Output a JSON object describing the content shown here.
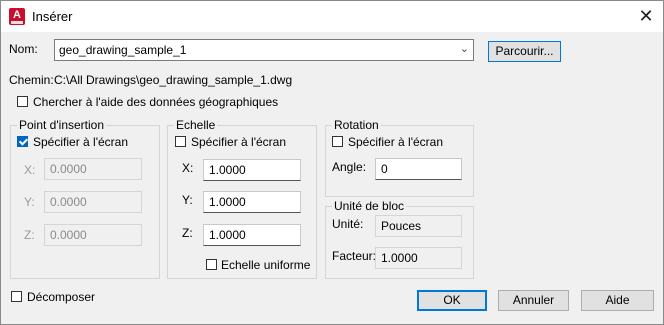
{
  "window": {
    "title": "Insérer",
    "close_glyph": "✕",
    "app_icon": "autocad-icon",
    "app_icon_letter": "A"
  },
  "name": {
    "label": "Nom:",
    "value": "geo_drawing_sample_1",
    "browse_label": "Parcourir..."
  },
  "path": {
    "label": "Chemin:",
    "value": "C:\\All Drawings\\geo_drawing_sample_1.dwg"
  },
  "geo_search": {
    "label": "Chercher à l'aide des données géographiques",
    "checked": false
  },
  "insertion": {
    "title": "Point d'insertion",
    "specify_label": "Spécifier à l'écran",
    "specify_checked": true,
    "x_label": "X:",
    "x_value": "0.0000",
    "y_label": "Y:",
    "y_value": "0.0000",
    "z_label": "Z:",
    "z_value": "0.0000"
  },
  "scale": {
    "title": "Echelle",
    "specify_label": "Spécifier à l'écran",
    "specify_checked": false,
    "x_label": "X:",
    "x_value": "1.0000",
    "y_label": "Y:",
    "y_value": "1.0000",
    "z_label": "Z:",
    "z_value": "1.0000",
    "uniform_label": "Echelle uniforme",
    "uniform_checked": false
  },
  "rotation": {
    "title": "Rotation",
    "specify_label": "Spécifier à l'écran",
    "specify_checked": false,
    "angle_label": "Angle:",
    "angle_value": "0"
  },
  "block_unit": {
    "title": "Unité de bloc",
    "unit_label": "Unité:",
    "unit_value": "Pouces",
    "factor_label": "Facteur:",
    "factor_value": "1.0000"
  },
  "explode": {
    "label": "Décomposer",
    "checked": false
  },
  "buttons": {
    "ok": "OK",
    "cancel": "Annuler",
    "help": "Aide"
  }
}
